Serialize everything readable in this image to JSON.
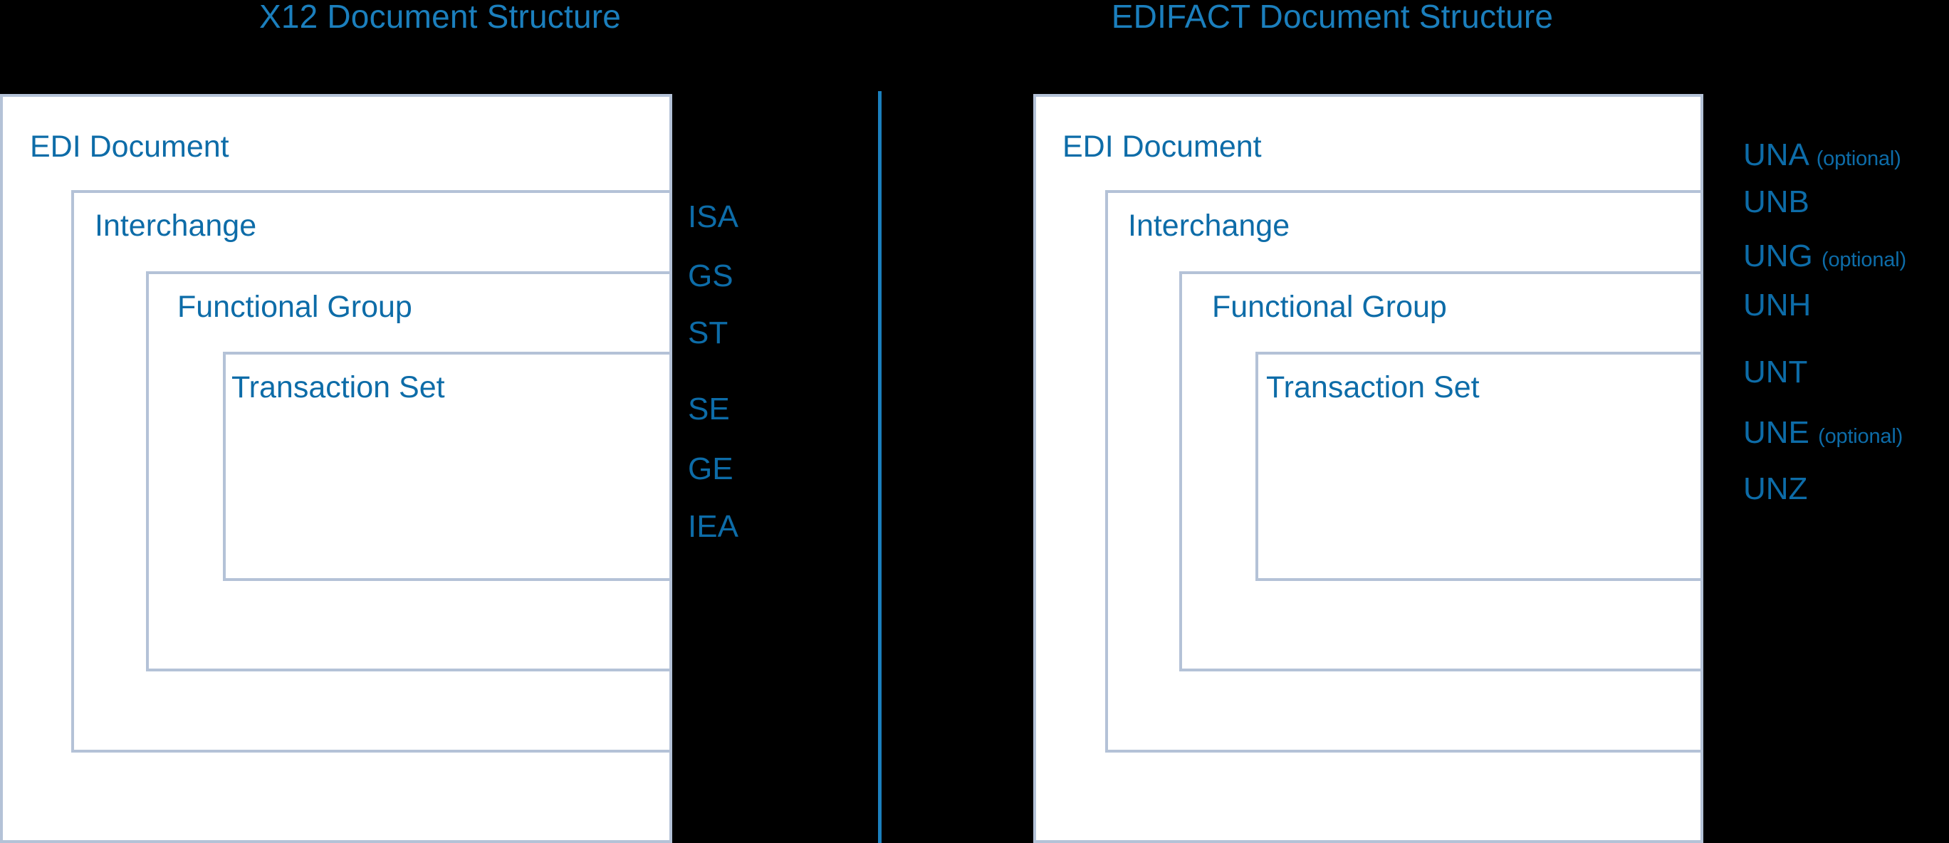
{
  "diagram": {
    "background_color": "#000000",
    "accent_color": "#1b7fbd",
    "text_color": "#0d6ca8",
    "box_border_color": "#b4c2d7",
    "box_fill_color": "#ffffff"
  },
  "panels": [
    {
      "id": "x12",
      "title": "X12 Document Structure",
      "levels": [
        {
          "label": "EDI Document"
        },
        {
          "label": "Interchange"
        },
        {
          "label": "Functional Group"
        },
        {
          "label": "Transaction Set"
        }
      ],
      "segments": [
        {
          "code": "ISA",
          "optional_note": ""
        },
        {
          "code": "GS",
          "optional_note": ""
        },
        {
          "code": "ST",
          "optional_note": ""
        },
        {
          "code": "SE",
          "optional_note": ""
        },
        {
          "code": "GE",
          "optional_note": ""
        },
        {
          "code": "IEA",
          "optional_note": ""
        }
      ]
    },
    {
      "id": "edifact",
      "title": "EDIFACT Document Structure",
      "levels": [
        {
          "label": "EDI Document"
        },
        {
          "label": "Interchange"
        },
        {
          "label": "Functional Group"
        },
        {
          "label": "Transaction Set"
        }
      ],
      "segments": [
        {
          "code": "UNA",
          "optional_note": "(optional)"
        },
        {
          "code": "UNB",
          "optional_note": ""
        },
        {
          "code": "UNG",
          "optional_note": "(optional)"
        },
        {
          "code": "UNH",
          "optional_note": ""
        },
        {
          "code": "UNT",
          "optional_note": ""
        },
        {
          "code": "UNE",
          "optional_note": "(optional)"
        },
        {
          "code": "UNZ",
          "optional_note": ""
        }
      ]
    }
  ]
}
